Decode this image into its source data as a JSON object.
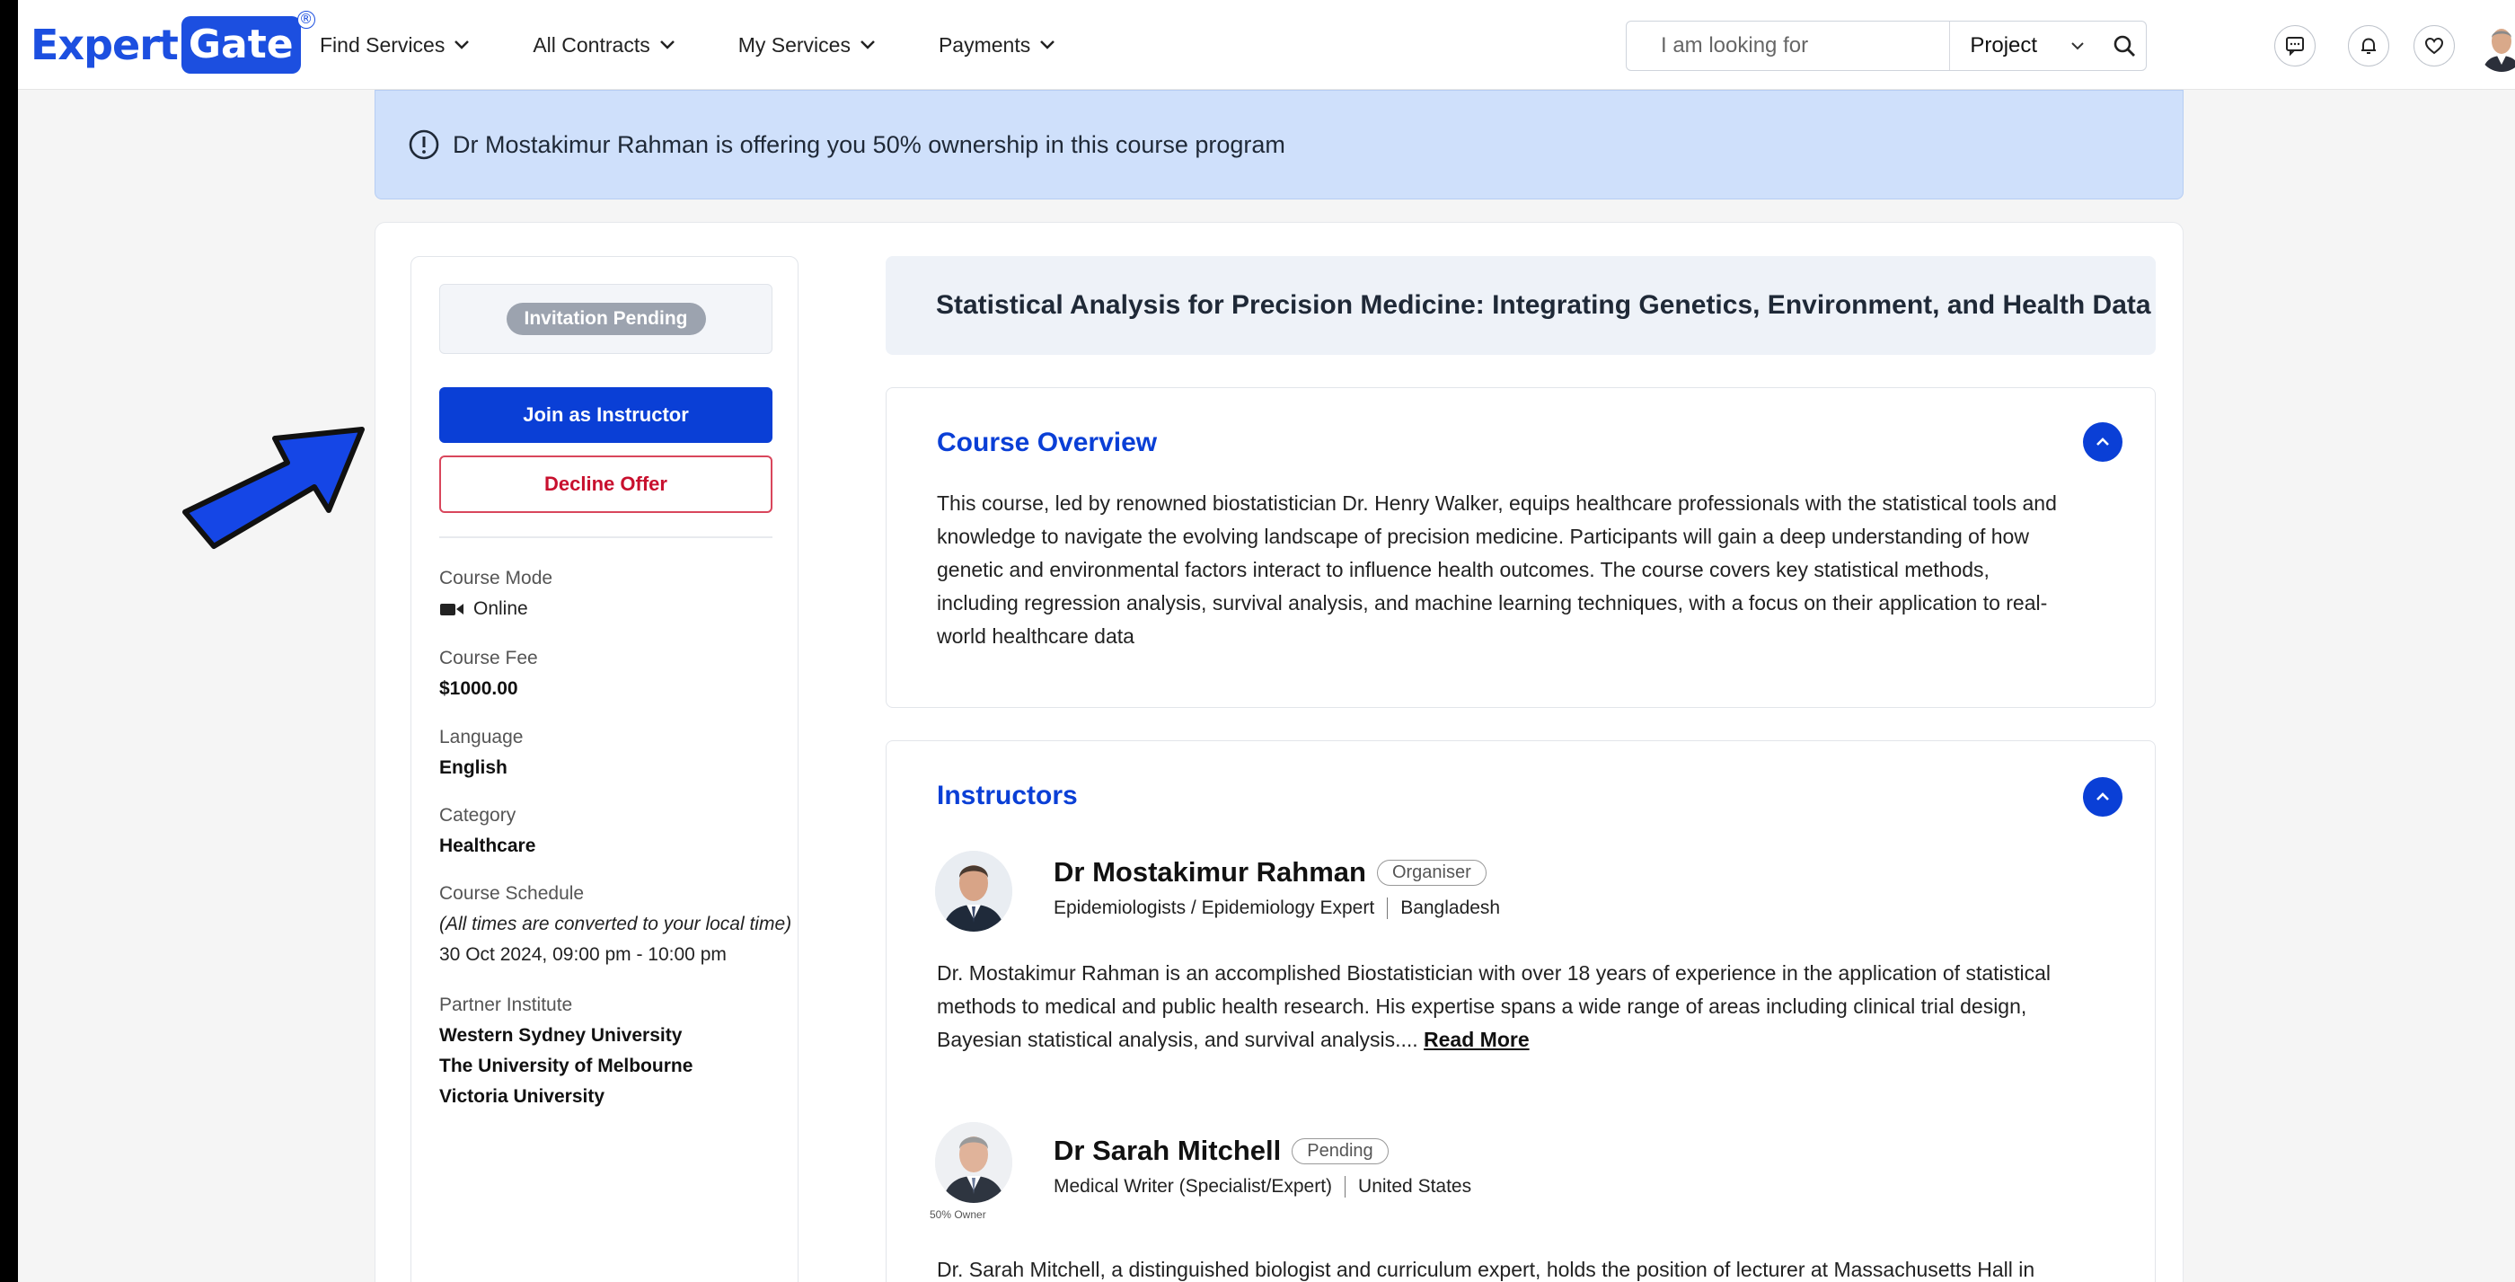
{
  "header": {
    "logo_expert": "Expert",
    "logo_gate": "Gate",
    "logo_reg": "®",
    "nav": [
      {
        "label": "Find Services",
        "icon": "chevron-down-icon"
      },
      {
        "label": "All Contracts",
        "icon": "chevron-down-icon"
      },
      {
        "label": "My Services",
        "icon": "chevron-down-icon"
      },
      {
        "label": "Payments",
        "icon": "chevron-down-icon"
      }
    ],
    "search": {
      "placeholder": "I am looking for",
      "value": "",
      "type_selected": "Project"
    },
    "icons": [
      "message-icon",
      "bell-icon",
      "heart-icon",
      "user-avatar"
    ]
  },
  "alert": {
    "icon": "info-circle-icon",
    "text": "Dr Mostakimur Rahman is offering you 50% ownership in this course program"
  },
  "sidebar": {
    "status": "Invitation Pending",
    "join_label": "Join as Instructor",
    "decline_label": "Decline Offer",
    "course_mode_label": "Course Mode",
    "course_mode_value": "Online",
    "course_fee_label": "Course Fee",
    "course_fee_value": "$1000.00",
    "language_label": "Language",
    "language_value": "English",
    "category_label": "Category",
    "category_value": "Healthcare",
    "schedule_label": "Course Schedule",
    "schedule_note": "(All times are converted to your local time)",
    "schedule_value": "30 Oct 2024,  09:00 pm - 10:00 pm",
    "partner_label": "Partner Institute",
    "partners": [
      "Western Sydney University",
      "The University of Melbourne",
      "Victoria University"
    ]
  },
  "course": {
    "title": "Statistical Analysis for Precision Medicine: Integrating Genetics, Environment, and Health Data",
    "overview_heading": "Course Overview",
    "overview_lines": [
      "This course, led by renowned biostatistician Dr. Henry Walker, equips healthcare professionals with the statistical tools and",
      "knowledge to navigate the evolving landscape of precision medicine. Participants will gain a deep understanding of how",
      "genetic and environmental factors interact to influence health outcomes. The course covers key statistical methods,",
      "including regression analysis, survival analysis, and machine learning techniques, with a focus on their application to real-",
      "world healthcare data"
    ],
    "instructors_heading": "Instructors",
    "instructors": [
      {
        "name": "Dr Mostakimur Rahman",
        "role": "Organiser",
        "title": "Epidemiologists / Epidemiology Expert",
        "country": "Bangladesh",
        "bio_lines": [
          "Dr. Mostakimur Rahman is an accomplished Biostatistician with over 18 years of experience in the application of statistical",
          "methods to medical and public health research. His expertise spans a wide range of areas including clinical trial design,",
          "Bayesian statistical analysis, and survival analysis.... "
        ],
        "read_more": "Read More"
      },
      {
        "name": "Dr Sarah Mitchell",
        "role": "Pending",
        "title": "Medical Writer (Specialist/Expert)",
        "country": "United States",
        "owner_tag": "50% Owner",
        "bio_line": "Dr. Sarah Mitchell, a distinguished biologist and curriculum expert, holds the position of lecturer at Massachusetts Hall in"
      }
    ]
  },
  "colors": {
    "brand": "#1c4fe0",
    "primary_button": "#0a3fd6",
    "decline": "#c8102e",
    "alert_bg": "#cfe0fb",
    "arrow": "#1546e6"
  }
}
